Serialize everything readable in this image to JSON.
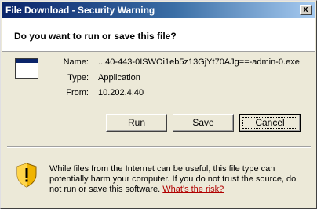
{
  "window": {
    "title": "File Download - Security Warning",
    "close_glyph": "x"
  },
  "header": {
    "question": "Do you want to run or save this file?"
  },
  "file": {
    "name_label": "Name:",
    "name_value": "...40-443-0ISWOi1eb5z13GjYt70AJg==-admin-0.exe",
    "type_label": "Type:",
    "type_value": "Application",
    "from_label": "From:",
    "from_value": "10.202.4.40"
  },
  "buttons": {
    "run_first": "R",
    "run_rest": "un",
    "save_first": "S",
    "save_rest": "ave",
    "cancel": "Cancel"
  },
  "warning": {
    "text": "While files from the Internet can be useful, this file type can potentially harm your computer. If you do not trust the source, do not run or save this software.",
    "link": "What's the risk?"
  },
  "icons": {
    "app": "application-window-icon",
    "shield": "security-shield-warning-icon"
  },
  "colors": {
    "titlebar_start": "#0a246a",
    "titlebar_end": "#a6caf0",
    "dialog_bg": "#ece9d8",
    "link": "#b00000"
  }
}
